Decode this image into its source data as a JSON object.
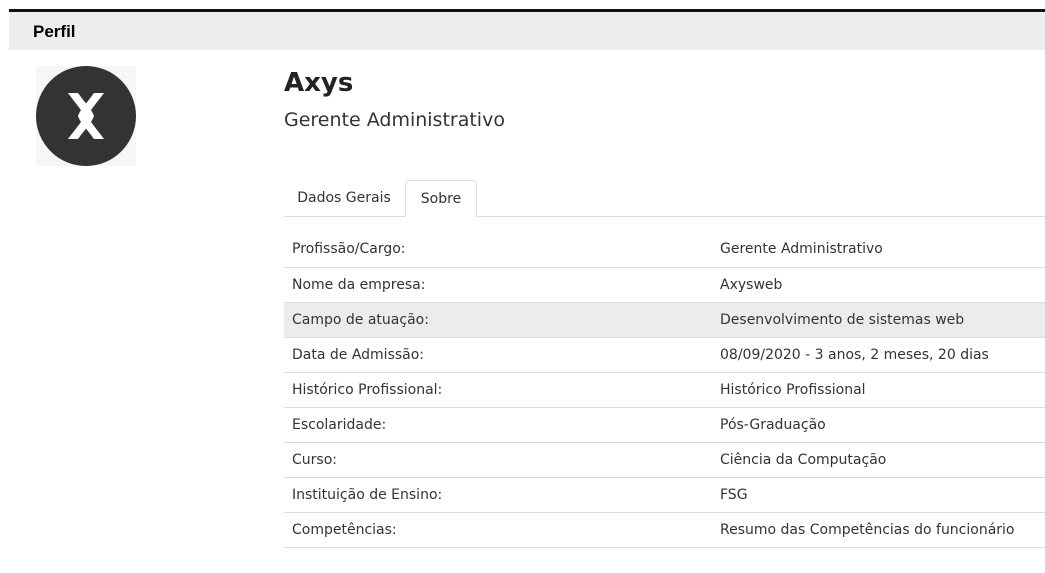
{
  "panel": {
    "title": "Perfil"
  },
  "logo": {
    "icon": "axys-x-logo",
    "bg": "#333333",
    "fg": "#ffffff"
  },
  "profile": {
    "name": "Axys",
    "role": "Gerente Administrativo"
  },
  "tabs": [
    {
      "label": "Dados Gerais",
      "active": false
    },
    {
      "label": "Sobre",
      "active": true
    }
  ],
  "details": [
    {
      "label": "Profissão/Cargo:",
      "value": "Gerente Administrativo"
    },
    {
      "label": "Nome da empresa:",
      "value": "Axysweb"
    },
    {
      "label": "Campo de atuação:",
      "value": "Desenvolvimento de sistemas web"
    },
    {
      "label": "Data de Admissão:",
      "value": "08/09/2020 - 3 anos, 2 meses, 20 dias"
    },
    {
      "label": "Histórico Profissional:",
      "value": "Histórico Profissional"
    },
    {
      "label": "Escolaridade:",
      "value": "Pós-Graduação"
    },
    {
      "label": "Curso:",
      "value": "Ciência da Computação"
    },
    {
      "label": "Instituição de Ensino:",
      "value": "FSG"
    },
    {
      "label": "Competências:",
      "value": "Resumo das Competências do funcionário"
    }
  ]
}
